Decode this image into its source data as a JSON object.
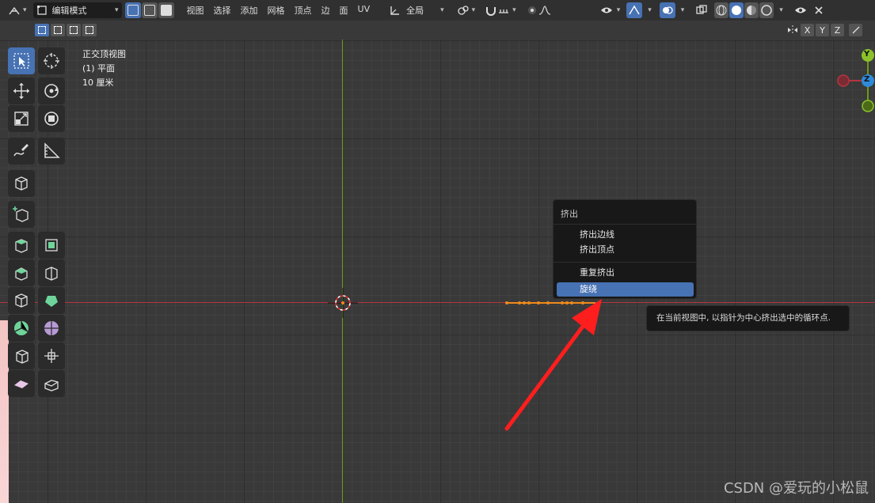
{
  "header": {
    "mode_label": "编辑模式",
    "menus": [
      "视图",
      "选择",
      "添加",
      "网格",
      "顶点",
      "边",
      "面",
      "UV"
    ],
    "transform_orientation": "全局"
  },
  "axis_buttons": [
    "X",
    "Y",
    "Z"
  ],
  "viewport_info": {
    "view_name": "正交顶视图",
    "object_name": "(1) 平面",
    "scale": "10 厘米"
  },
  "gizmo": {
    "y_label": "Y",
    "z_label": "Z"
  },
  "menu": {
    "title": "挤出",
    "items": [
      {
        "label": "挤出边线"
      },
      {
        "label": "挤出顶点"
      },
      {
        "label": "重复挤出"
      },
      {
        "label": "旋绕"
      }
    ]
  },
  "tooltip": "在当前视图中, 以指针为中心挤出选中的循环点.",
  "watermark": "CSDN @爱玩的小松鼠",
  "colors": {
    "accent": "#4772b3",
    "x_axis": "#b5343f",
    "y_axis": "#6d9a1a",
    "selection": "#f08a1c",
    "arrow": "#ff1e1e"
  }
}
